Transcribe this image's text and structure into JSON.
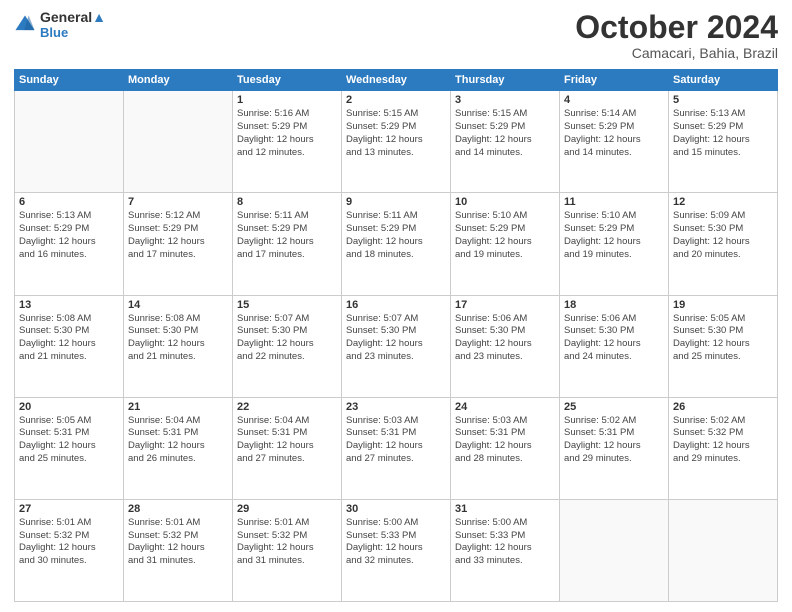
{
  "header": {
    "logo_line1": "General",
    "logo_line2": "Blue",
    "month": "October 2024",
    "location": "Camacari, Bahia, Brazil"
  },
  "weekdays": [
    "Sunday",
    "Monday",
    "Tuesday",
    "Wednesday",
    "Thursday",
    "Friday",
    "Saturday"
  ],
  "weeks": [
    [
      {
        "day": "",
        "info": ""
      },
      {
        "day": "",
        "info": ""
      },
      {
        "day": "1",
        "info": "Sunrise: 5:16 AM\nSunset: 5:29 PM\nDaylight: 12 hours\nand 12 minutes."
      },
      {
        "day": "2",
        "info": "Sunrise: 5:15 AM\nSunset: 5:29 PM\nDaylight: 12 hours\nand 13 minutes."
      },
      {
        "day": "3",
        "info": "Sunrise: 5:15 AM\nSunset: 5:29 PM\nDaylight: 12 hours\nand 14 minutes."
      },
      {
        "day": "4",
        "info": "Sunrise: 5:14 AM\nSunset: 5:29 PM\nDaylight: 12 hours\nand 14 minutes."
      },
      {
        "day": "5",
        "info": "Sunrise: 5:13 AM\nSunset: 5:29 PM\nDaylight: 12 hours\nand 15 minutes."
      }
    ],
    [
      {
        "day": "6",
        "info": "Sunrise: 5:13 AM\nSunset: 5:29 PM\nDaylight: 12 hours\nand 16 minutes."
      },
      {
        "day": "7",
        "info": "Sunrise: 5:12 AM\nSunset: 5:29 PM\nDaylight: 12 hours\nand 17 minutes."
      },
      {
        "day": "8",
        "info": "Sunrise: 5:11 AM\nSunset: 5:29 PM\nDaylight: 12 hours\nand 17 minutes."
      },
      {
        "day": "9",
        "info": "Sunrise: 5:11 AM\nSunset: 5:29 PM\nDaylight: 12 hours\nand 18 minutes."
      },
      {
        "day": "10",
        "info": "Sunrise: 5:10 AM\nSunset: 5:29 PM\nDaylight: 12 hours\nand 19 minutes."
      },
      {
        "day": "11",
        "info": "Sunrise: 5:10 AM\nSunset: 5:29 PM\nDaylight: 12 hours\nand 19 minutes."
      },
      {
        "day": "12",
        "info": "Sunrise: 5:09 AM\nSunset: 5:30 PM\nDaylight: 12 hours\nand 20 minutes."
      }
    ],
    [
      {
        "day": "13",
        "info": "Sunrise: 5:08 AM\nSunset: 5:30 PM\nDaylight: 12 hours\nand 21 minutes."
      },
      {
        "day": "14",
        "info": "Sunrise: 5:08 AM\nSunset: 5:30 PM\nDaylight: 12 hours\nand 21 minutes."
      },
      {
        "day": "15",
        "info": "Sunrise: 5:07 AM\nSunset: 5:30 PM\nDaylight: 12 hours\nand 22 minutes."
      },
      {
        "day": "16",
        "info": "Sunrise: 5:07 AM\nSunset: 5:30 PM\nDaylight: 12 hours\nand 23 minutes."
      },
      {
        "day": "17",
        "info": "Sunrise: 5:06 AM\nSunset: 5:30 PM\nDaylight: 12 hours\nand 23 minutes."
      },
      {
        "day": "18",
        "info": "Sunrise: 5:06 AM\nSunset: 5:30 PM\nDaylight: 12 hours\nand 24 minutes."
      },
      {
        "day": "19",
        "info": "Sunrise: 5:05 AM\nSunset: 5:30 PM\nDaylight: 12 hours\nand 25 minutes."
      }
    ],
    [
      {
        "day": "20",
        "info": "Sunrise: 5:05 AM\nSunset: 5:31 PM\nDaylight: 12 hours\nand 25 minutes."
      },
      {
        "day": "21",
        "info": "Sunrise: 5:04 AM\nSunset: 5:31 PM\nDaylight: 12 hours\nand 26 minutes."
      },
      {
        "day": "22",
        "info": "Sunrise: 5:04 AM\nSunset: 5:31 PM\nDaylight: 12 hours\nand 27 minutes."
      },
      {
        "day": "23",
        "info": "Sunrise: 5:03 AM\nSunset: 5:31 PM\nDaylight: 12 hours\nand 27 minutes."
      },
      {
        "day": "24",
        "info": "Sunrise: 5:03 AM\nSunset: 5:31 PM\nDaylight: 12 hours\nand 28 minutes."
      },
      {
        "day": "25",
        "info": "Sunrise: 5:02 AM\nSunset: 5:31 PM\nDaylight: 12 hours\nand 29 minutes."
      },
      {
        "day": "26",
        "info": "Sunrise: 5:02 AM\nSunset: 5:32 PM\nDaylight: 12 hours\nand 29 minutes."
      }
    ],
    [
      {
        "day": "27",
        "info": "Sunrise: 5:01 AM\nSunset: 5:32 PM\nDaylight: 12 hours\nand 30 minutes."
      },
      {
        "day": "28",
        "info": "Sunrise: 5:01 AM\nSunset: 5:32 PM\nDaylight: 12 hours\nand 31 minutes."
      },
      {
        "day": "29",
        "info": "Sunrise: 5:01 AM\nSunset: 5:32 PM\nDaylight: 12 hours\nand 31 minutes."
      },
      {
        "day": "30",
        "info": "Sunrise: 5:00 AM\nSunset: 5:33 PM\nDaylight: 12 hours\nand 32 minutes."
      },
      {
        "day": "31",
        "info": "Sunrise: 5:00 AM\nSunset: 5:33 PM\nDaylight: 12 hours\nand 33 minutes."
      },
      {
        "day": "",
        "info": ""
      },
      {
        "day": "",
        "info": ""
      }
    ]
  ]
}
